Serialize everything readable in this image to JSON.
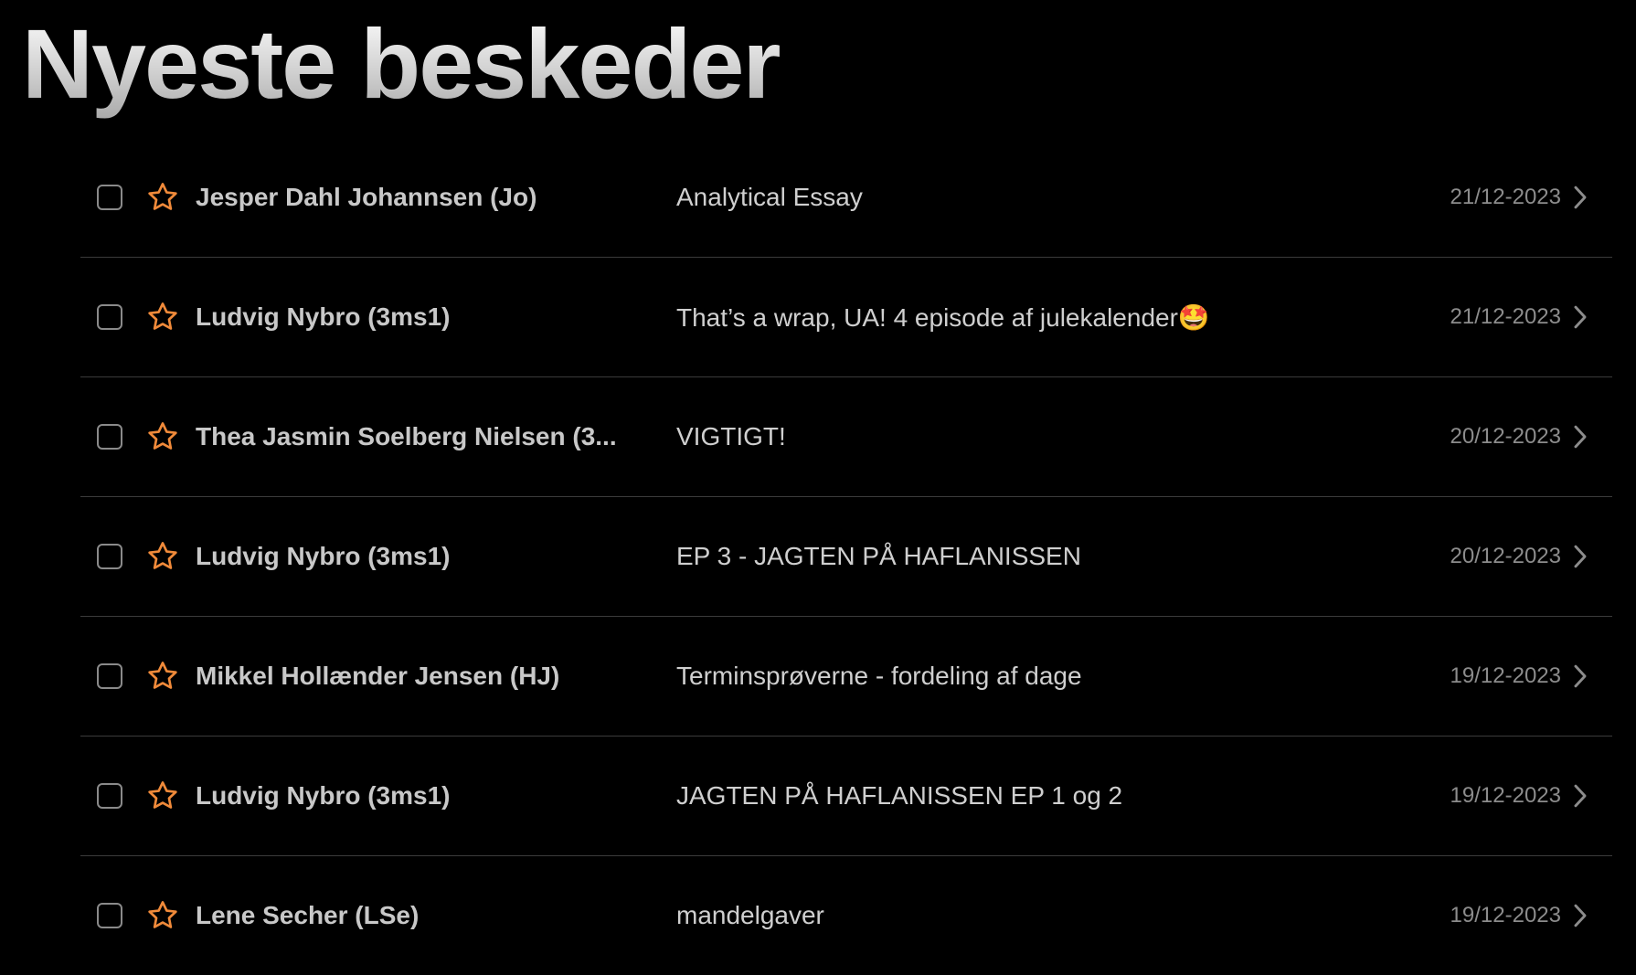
{
  "page": {
    "title": "Nyeste beskeder"
  },
  "colors": {
    "background": "#000000",
    "star_accent": "#f08a3a",
    "divider": "#3b3b3b",
    "sender_text": "#c8c8c8",
    "date_text": "#8c8c8c"
  },
  "icons": {
    "checkbox": "checkbox-icon",
    "star": "star-outline-icon",
    "chevron": "chevron-right-icon"
  },
  "messages": [
    {
      "sender": "Jesper Dahl Johannsen (Jo)",
      "subject": "Analytical Essay",
      "date": "21/12-2023"
    },
    {
      "sender": "Ludvig Nybro (3ms1)",
      "subject": "That’s a wrap, UA! 4 episode af julekalender🤩",
      "date": "21/12-2023"
    },
    {
      "sender": "Thea Jasmin Soelberg Nielsen (3...",
      "subject": "VIGTIGT!",
      "date": "20/12-2023"
    },
    {
      "sender": "Ludvig Nybro (3ms1)",
      "subject": "EP 3 - JAGTEN PÅ HAFLANISSEN",
      "date": "20/12-2023"
    },
    {
      "sender": "Mikkel Hollænder Jensen (HJ)",
      "subject": "Terminsprøverne - fordeling af dage",
      "date": "19/12-2023"
    },
    {
      "sender": "Ludvig Nybro (3ms1)",
      "subject": "JAGTEN PÅ HAFLANISSEN EP 1 og 2",
      "date": "19/12-2023"
    },
    {
      "sender": "Lene Secher (LSe)",
      "subject": "mandelgaver",
      "date": "19/12-2023"
    }
  ]
}
